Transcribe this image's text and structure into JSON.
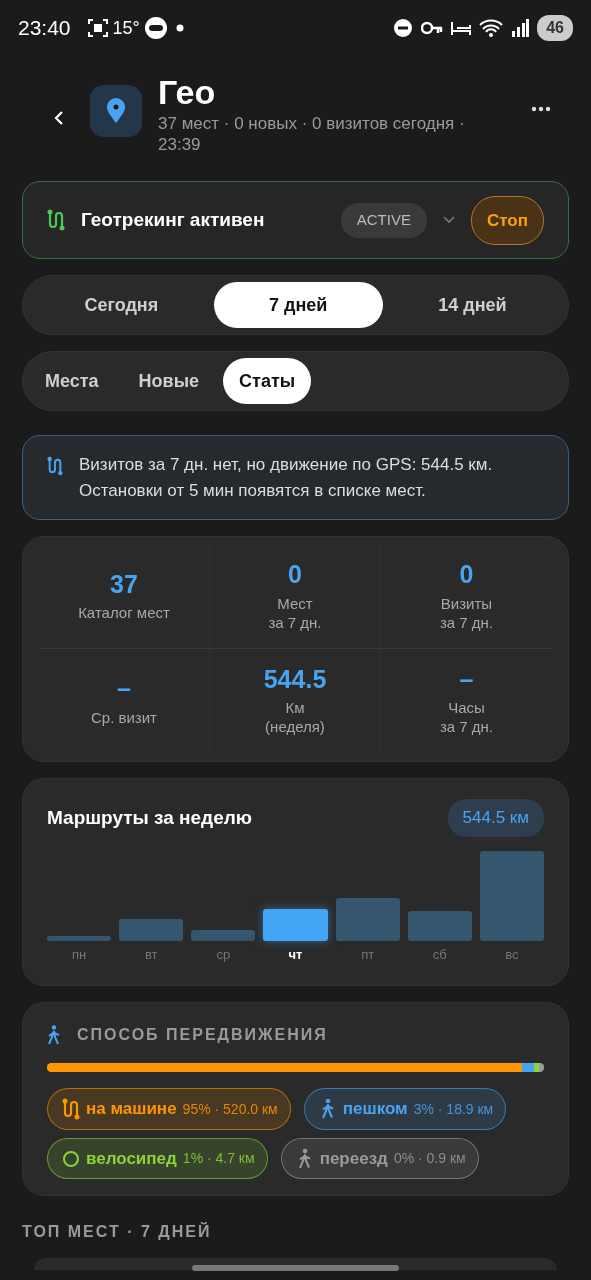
{
  "status_bar": {
    "time": "23:40",
    "temperature": "15°",
    "battery": "46"
  },
  "header": {
    "title": "Гео",
    "subtitle": "37 мест · 0 новых · 0 визитов сегодня · 23:39"
  },
  "tracking": {
    "label": "Геотрекинг активен",
    "badge": "ACTIVE",
    "stop_button": "Стоп"
  },
  "periods": [
    {
      "label": "Сегодня",
      "selected": false
    },
    {
      "label": "7 дней",
      "selected": true
    },
    {
      "label": "14 дней",
      "selected": false
    }
  ],
  "tabs": [
    {
      "label": "Места",
      "selected": false
    },
    {
      "label": "Новые",
      "selected": false
    },
    {
      "label": "Статы",
      "selected": true
    }
  ],
  "info": "Визитов за 7 дн. нет, но движение по GPS: 544.5 км. Остановки от 5 мин появятся в списке мест.",
  "stats": [
    {
      "value": "37",
      "label": "Каталог мест"
    },
    {
      "value": "0",
      "label": "Мест\nза 7 дн."
    },
    {
      "value": "0",
      "label": "Визиты\nза 7 дн."
    },
    {
      "value": "–",
      "label": "Ср. визит"
    },
    {
      "value": "544.5",
      "label": "Км\n(неделя)"
    },
    {
      "value": "–",
      "label": "Часы\nза 7 дн."
    }
  ],
  "routes": {
    "title": "Маршруты за неделю",
    "total": "544.5 км",
    "days": [
      {
        "label": "пн",
        "selected": false
      },
      {
        "label": "вт",
        "selected": false
      },
      {
        "label": "ср",
        "selected": false
      },
      {
        "label": "чт",
        "selected": true
      },
      {
        "label": "пт",
        "selected": false
      },
      {
        "label": "сб",
        "selected": false
      },
      {
        "label": "вс",
        "selected": false
      }
    ]
  },
  "transport": {
    "title": "СПОСОБ ПЕРЕДВИЖЕНИЯ",
    "modes": [
      {
        "kind": "car",
        "name": "на машине",
        "detail": "95% · 520.0 км",
        "color": "#ff9500"
      },
      {
        "kind": "walk",
        "name": "пешком",
        "detail": "3% · 18.9 км",
        "color": "#4aa3f0"
      },
      {
        "kind": "bike",
        "name": "велосипед",
        "detail": "1% · 4.7 км",
        "color": "#8bd43a"
      },
      {
        "kind": "move",
        "name": "переезд",
        "detail": "0% · 0.9 км",
        "color": "#9a9a9a"
      }
    ]
  },
  "top_places_heading": "ТОП МЕСТ · 7 ДНЕЙ"
}
